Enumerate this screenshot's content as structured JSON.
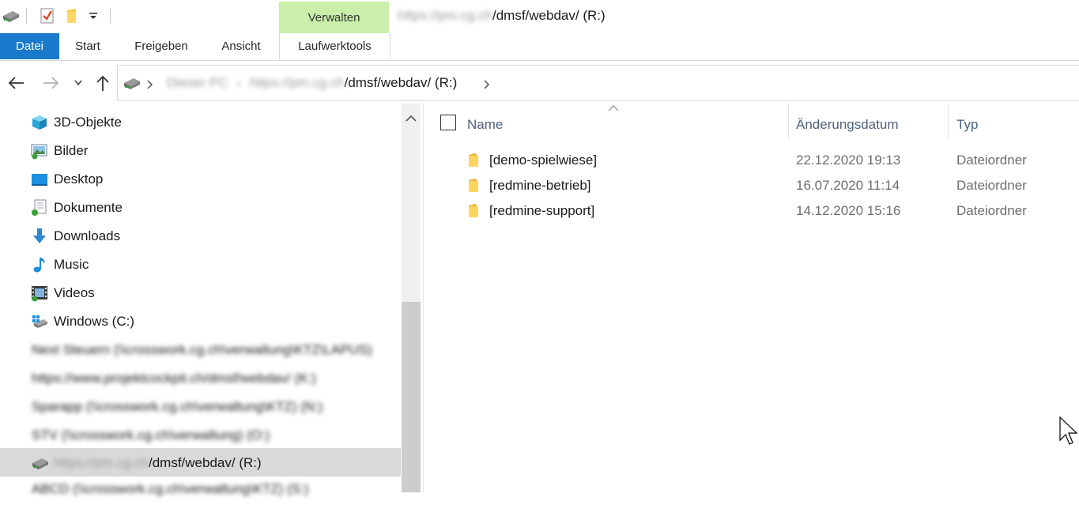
{
  "title": {
    "blurred_prefix": "https://pm.cg.ch",
    "path": "/dmsf/webdav/ (R:)",
    "context_tab": "Verwalten"
  },
  "ribbon": {
    "tabs": [
      "Datei",
      "Start",
      "Freigeben",
      "Ansicht",
      "Laufwerktools"
    ],
    "accent": "#1979ca",
    "context_color": "#c9efab"
  },
  "address": {
    "blurred_1": "Dieser PC",
    "blurred_2": "https://pm.cg.ch",
    "path": "/dmsf/webdav/ (R:)"
  },
  "nav": {
    "items": [
      {
        "label": "3D-Objekte",
        "icon": "3d-objects-icon"
      },
      {
        "label": "Bilder",
        "icon": "pictures-icon"
      },
      {
        "label": "Desktop",
        "icon": "desktop-icon"
      },
      {
        "label": "Dokumente",
        "icon": "documents-icon"
      },
      {
        "label": "Downloads",
        "icon": "downloads-icon"
      },
      {
        "label": "Music",
        "icon": "music-icon"
      },
      {
        "label": "Videos",
        "icon": "videos-icon"
      },
      {
        "label": "Windows (C:)",
        "icon": "windows-drive-icon"
      }
    ],
    "blurred_items": [
      "Next Steuern (\\\\crosswork.cg.ch\\verwaltung\\KTZ\\LAPUS)",
      "https://www.projektcockpit.ch/dmsf/webdav/ (K:)",
      "Sparapp (\\\\crosswork.cg.ch\\verwaltung\\KTZ) (N:)",
      "STV (\\\\crosswork.cg.ch\\verwaltung) (O:)"
    ],
    "selected": {
      "blurred_prefix": "https://pm.cg.ch",
      "label": "/dmsf/webdav/ (R:)"
    },
    "blurred_last": "ABCD (\\\\crosswork.cg.ch\\verwaltung\\KTZ) (S:)"
  },
  "columns": {
    "name": "Name",
    "date": "Änderungsdatum",
    "type": "Typ"
  },
  "files": [
    {
      "name": "[demo-spielwiese]",
      "date": "22.12.2020 19:13",
      "type": "Dateiordner"
    },
    {
      "name": "[redmine-betrieb]",
      "date": "16.07.2020 11:14",
      "type": "Dateiordner"
    },
    {
      "name": "[redmine-support]",
      "date": "14.12.2020 15:16",
      "type": "Dateiordner"
    }
  ]
}
